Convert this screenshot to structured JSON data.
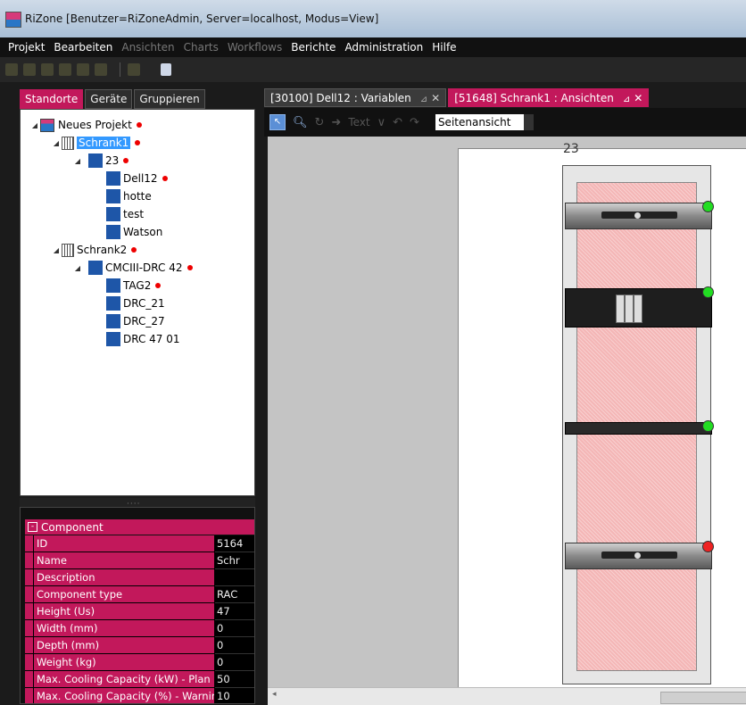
{
  "window": {
    "title": "RiZone [Benutzer=RiZoneAdmin, Server=localhost, Modus=View]"
  },
  "menu": [
    {
      "label": "Projekt",
      "enabled": true
    },
    {
      "label": "Bearbeiten",
      "enabled": true
    },
    {
      "label": "Ansichten",
      "enabled": false
    },
    {
      "label": "Charts",
      "enabled": false
    },
    {
      "label": "Workflows",
      "enabled": false
    },
    {
      "label": "Berichte",
      "enabled": true
    },
    {
      "label": "Administration",
      "enabled": true
    },
    {
      "label": "Hilfe",
      "enabled": true
    }
  ],
  "left_tabs": [
    "Standorte",
    "Geräte",
    "Gruppieren"
  ],
  "tree": [
    {
      "label": "Neues Projekt",
      "level": 0,
      "icon": "project-icon",
      "expanded": true,
      "alarm": true
    },
    {
      "label": "Schrank1",
      "level": 1,
      "icon": "rack-icon",
      "expanded": true,
      "alarm": true,
      "selected": true
    },
    {
      "label": "23",
      "level": 2,
      "icon": "unit-icon",
      "expanded": true,
      "alarm": true
    },
    {
      "label": "Dell12",
      "level": 3,
      "icon": "device-icon",
      "alarm": true
    },
    {
      "label": "hotte",
      "level": 3,
      "icon": "device-icon"
    },
    {
      "label": "test",
      "level": 3,
      "icon": "device-icon"
    },
    {
      "label": "Watson",
      "level": 3,
      "icon": "device-icon"
    },
    {
      "label": "Schrank2",
      "level": 0.5,
      "icon": "rack-icon",
      "expanded": true,
      "alarm": true
    },
    {
      "label": "CMCIII-DRC 42",
      "level": 2,
      "icon": "unit-icon",
      "expanded": true,
      "alarm": true
    },
    {
      "label": "TAG2",
      "level": 3,
      "icon": "device-icon",
      "alarm": true
    },
    {
      "label": "DRC_21",
      "level": 3,
      "icon": "device-icon"
    },
    {
      "label": "DRC_27",
      "level": 3,
      "icon": "device-icon"
    },
    {
      "label": "DRC 47 01",
      "level": 3,
      "icon": "device-icon"
    }
  ],
  "properties": {
    "section": "Component",
    "rows": [
      {
        "name": "ID",
        "value": "5164"
      },
      {
        "name": "Name",
        "value": "Schr"
      },
      {
        "name": "Description",
        "value": ""
      },
      {
        "name": "Component type",
        "value": "RAC"
      },
      {
        "name": "Height (Us)",
        "value": "47"
      },
      {
        "name": "Width (mm)",
        "value": "0"
      },
      {
        "name": "Depth (mm)",
        "value": "0"
      },
      {
        "name": "Weight (kg)",
        "value": "0"
      },
      {
        "name": "Max. Cooling Capacity (kW) - Plan",
        "value": "50"
      },
      {
        "name": "Max. Cooling Capacity (%) - Warning",
        "value": "10"
      }
    ]
  },
  "doc_tabs": [
    {
      "label": "[30100] Dell12 : Variablen",
      "active": false
    },
    {
      "label": "[51648] Schrank1 : Ansichten",
      "active": true
    }
  ],
  "viewbar": {
    "text_tool": "Text",
    "view_select": "Seitenansicht"
  },
  "rack": {
    "label": "23",
    "units": [
      {
        "type": "server",
        "status": "ok",
        "status_color": "#22dd22"
      },
      {
        "type": "blade",
        "status": "ok",
        "status_color": "#22dd22"
      },
      {
        "type": "switch",
        "status": "ok",
        "status_color": "#22dd22"
      },
      {
        "type": "server",
        "status": "alarm",
        "status_color": "#ee2222"
      }
    ]
  }
}
